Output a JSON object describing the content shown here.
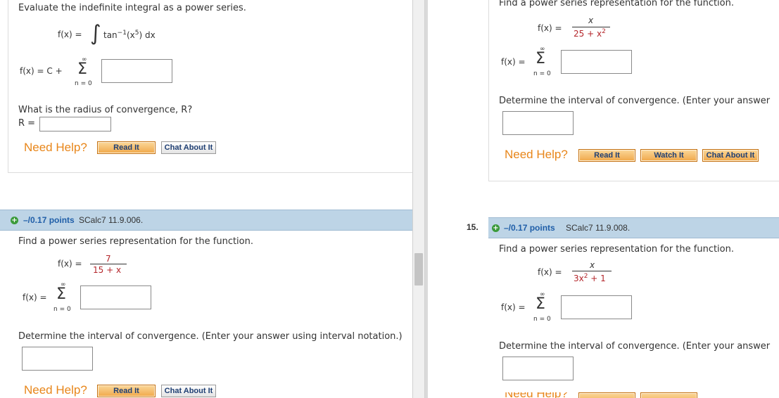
{
  "left": {
    "q1": {
      "prompt": "Evaluate the indefinite integral as a power series.",
      "fx": "f(x) =",
      "integral_sign": "∫",
      "integrand_fn": "tan",
      "integrand_exp": "−1",
      "integrand_arg": "(x",
      "integrand_arg_exp": "5",
      "integrand_tail": ") dx",
      "series_prefix": "f(x) = C +",
      "sigma_top": "∞",
      "sigma": "Σ",
      "sigma_bottom": "n = 0",
      "radius_question": "What is the radius of convergence, R?",
      "radius_label": "R =",
      "need_help": "Need Help?",
      "read_it": "Read It",
      "chat_about_it": "Chat About It"
    },
    "q2": {
      "points": "–/0.17 points",
      "source": "SCalc7 11.9.006.",
      "prompt": "Find a power series representation for the function.",
      "fx": "f(x) =",
      "numerator": "7",
      "denominator": "15 + x",
      "series_prefix": "f(x) =",
      "sigma_top": "∞",
      "sigma": "Σ",
      "sigma_bottom": "n = 0",
      "interval_prompt": "Determine the interval of convergence. (Enter your answer using interval notation.)",
      "need_help": "Need Help?",
      "read_it": "Read It",
      "chat_about_it": "Chat About It"
    }
  },
  "right": {
    "q1": {
      "prompt": "Find a power series representation for the function.",
      "fx": "f(x) =",
      "numerator": "x",
      "den_base": "25 + x",
      "den_exp": "2",
      "series_prefix": "f(x) =",
      "sigma_top": "∞",
      "sigma": "Σ",
      "sigma_bottom": "n = 0",
      "interval_prompt": "Determine the interval of convergence. (Enter your answer",
      "need_help": "Need Help?",
      "read_it": "Read It",
      "watch_it": "Watch It",
      "chat_about_it": "Chat About It"
    },
    "q2": {
      "number": "15.",
      "points": "–/0.17 points",
      "source": "SCalc7 11.9.008.",
      "prompt": "Find a power series representation for the function.",
      "fx": "f(x) =",
      "numerator": "x",
      "den_base": "3x",
      "den_exp": "2",
      "den_tail": " + 1",
      "series_prefix": "f(x) =",
      "sigma_top": "∞",
      "sigma": "Σ",
      "sigma_bottom": "n = 0",
      "interval_prompt": "Determine the interval of convergence. (Enter your answer",
      "need_help": "Need Help?"
    }
  },
  "colors": {
    "accent_orange": "#e8861a",
    "points_blue": "#1f5ea8",
    "bar_blue": "#bdd4e6",
    "math_red": "#b4262b"
  }
}
